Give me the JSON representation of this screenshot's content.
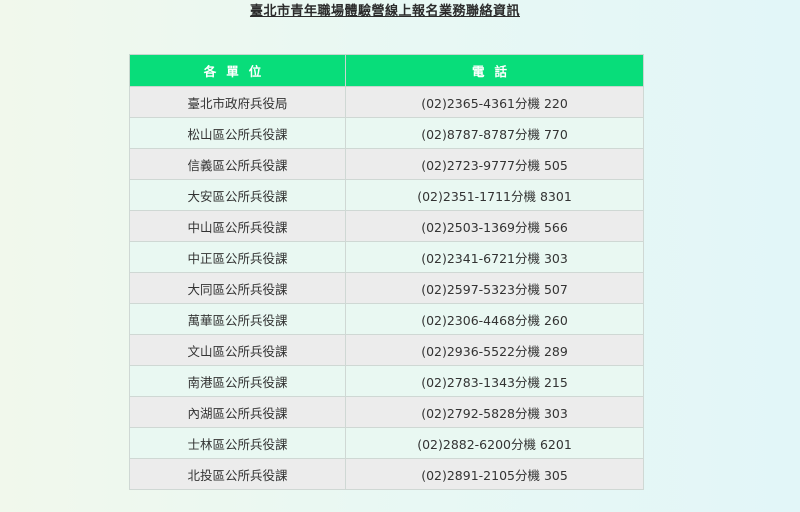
{
  "title": "臺北市青年職場體驗營線上報名業務聯絡資訊",
  "table": {
    "headers": [
      "各單位",
      "電話"
    ],
    "rows": [
      {
        "unit": "臺北市政府兵役局",
        "phone": "(02)2365-4361分機 220"
      },
      {
        "unit": "松山區公所兵役課",
        "phone": "(02)8787-8787分機 770"
      },
      {
        "unit": "信義區公所兵役課",
        "phone": "(02)2723-9777分機 505"
      },
      {
        "unit": "大安區公所兵役課",
        "phone": "(02)2351-1711分機 8301"
      },
      {
        "unit": "中山區公所兵役課",
        "phone": "(02)2503-1369分機 566"
      },
      {
        "unit": "中正區公所兵役課",
        "phone": "(02)2341-6721分機 303"
      },
      {
        "unit": "大同區公所兵役課",
        "phone": "(02)2597-5323分機 507"
      },
      {
        "unit": "萬華區公所兵役課",
        "phone": "(02)2306-4468分機 260"
      },
      {
        "unit": "文山區公所兵役課",
        "phone": "(02)2936-5522分機 289"
      },
      {
        "unit": "南港區公所兵役課",
        "phone": "(02)2783-1343分機 215"
      },
      {
        "unit": "內湖區公所兵役課",
        "phone": "(02)2792-5828分機 303"
      },
      {
        "unit": "士林區公所兵役課",
        "phone": "(02)2882-6200分機 6201"
      },
      {
        "unit": "北投區公所兵役課",
        "phone": "(02)2891-2105分機 305"
      }
    ]
  },
  "colors": {
    "header_bg": "#08dd7a",
    "row_odd_bg": "#ececec",
    "row_even_bg": "#e9f8f2"
  }
}
